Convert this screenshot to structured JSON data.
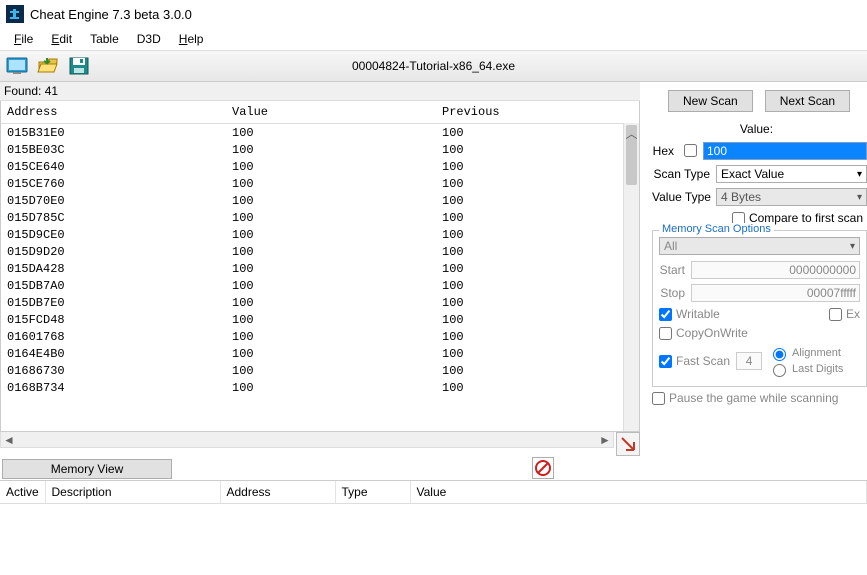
{
  "window": {
    "title": "Cheat Engine 7.3 beta 3.0.0"
  },
  "menu": {
    "file": "File",
    "edit": "Edit",
    "table": "Table",
    "d3d": "D3D",
    "help": "Help"
  },
  "process": {
    "name": "00004824-Tutorial-x86_64.exe"
  },
  "found": {
    "label": "Found: 41"
  },
  "columns": {
    "address": "Address",
    "value": "Value",
    "previous": "Previous"
  },
  "rows": [
    {
      "addr": "015B31E0",
      "val": "100",
      "prev": "100"
    },
    {
      "addr": "015BE03C",
      "val": "100",
      "prev": "100"
    },
    {
      "addr": "015CE640",
      "val": "100",
      "prev": "100"
    },
    {
      "addr": "015CE760",
      "val": "100",
      "prev": "100"
    },
    {
      "addr": "015D70E0",
      "val": "100",
      "prev": "100"
    },
    {
      "addr": "015D785C",
      "val": "100",
      "prev": "100"
    },
    {
      "addr": "015D9CE0",
      "val": "100",
      "prev": "100"
    },
    {
      "addr": "015D9D20",
      "val": "100",
      "prev": "100"
    },
    {
      "addr": "015DA428",
      "val": "100",
      "prev": "100"
    },
    {
      "addr": "015DB7A0",
      "val": "100",
      "prev": "100"
    },
    {
      "addr": "015DB7E0",
      "val": "100",
      "prev": "100"
    },
    {
      "addr": "015FCD48",
      "val": "100",
      "prev": "100"
    },
    {
      "addr": "01601768",
      "val": "100",
      "prev": "100"
    },
    {
      "addr": "0164E4B0",
      "val": "100",
      "prev": "100"
    },
    {
      "addr": "01686730",
      "val": "100",
      "prev": "100"
    },
    {
      "addr": "0168B734",
      "val": "100",
      "prev": "100"
    }
  ],
  "scan": {
    "new": "New Scan",
    "next": "Next Scan",
    "value_label": "Value:",
    "hex_label": "Hex",
    "value_input": "100",
    "scantype_label": "Scan Type",
    "scantype_value": "Exact Value",
    "valuetype_label": "Value Type",
    "valuetype_value": "4 Bytes",
    "compare": "Compare to first scan"
  },
  "memopts": {
    "legend": "Memory Scan Options",
    "preset": "All",
    "start_label": "Start",
    "start_value": "0000000000",
    "stop_label": "Stop",
    "stop_value": "00007fffff",
    "writable": "Writable",
    "ex": "Ex",
    "cow": "CopyOnWrite",
    "fastscan": "Fast Scan",
    "fast_value": "4",
    "alignment": "Alignment",
    "lastdigits": "Last Digits",
    "pause": "Pause the game while scanning"
  },
  "memview": "Memory View",
  "bottomcols": {
    "active": "Active",
    "desc": "Description",
    "addr": "Address",
    "type": "Type",
    "value": "Value"
  }
}
